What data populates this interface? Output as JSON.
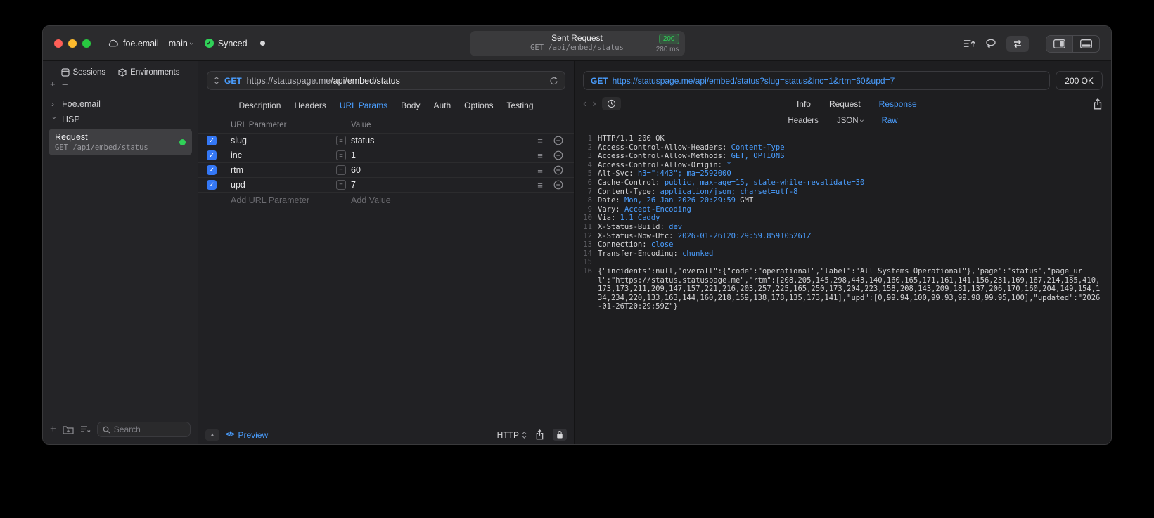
{
  "colors": {
    "accent_blue": "#4A9EFF",
    "success_green": "#30D158",
    "checkbox_blue": "#3478F6",
    "window_bg": "#212123"
  },
  "titlebar": {
    "project": "foe.email",
    "branch": "main",
    "sync_label": "Synced",
    "request_summary": {
      "title": "Sent Request",
      "status_code": "200",
      "method_path": "GET /api/embed/status",
      "duration": "280 ms"
    }
  },
  "sidebar": {
    "tabs": [
      {
        "label": "Sessions"
      },
      {
        "label": "Environments"
      }
    ],
    "tree": [
      {
        "label": "Foe.email"
      },
      {
        "label": "HSP"
      }
    ],
    "request_item": {
      "title": "Request",
      "subtitle": "GET /api/embed/status"
    },
    "search": {
      "placeholder": "Search"
    }
  },
  "request_editor": {
    "method": "GET",
    "url_host": "https://statuspage.me",
    "url_path": "/api/embed/status",
    "active_tab": "URL Params",
    "tabs": [
      {
        "label": "Description"
      },
      {
        "label": "Headers"
      },
      {
        "label": "URL Params"
      },
      {
        "label": "Body"
      },
      {
        "label": "Auth"
      },
      {
        "label": "Options"
      },
      {
        "label": "Testing"
      }
    ],
    "params": {
      "columns": [
        "URL Parameter",
        "Value"
      ],
      "rows": [
        {
          "name": "slug",
          "value": "status",
          "checked": true
        },
        {
          "name": "inc",
          "value": "1",
          "checked": true
        },
        {
          "name": "rtm",
          "value": "60",
          "checked": true
        },
        {
          "name": "upd",
          "value": "7",
          "checked": true
        }
      ],
      "add_param_placeholder": "Add URL Parameter",
      "add_value_placeholder": "Add Value"
    },
    "footer": {
      "preview": "Preview",
      "protocol": "HTTP"
    }
  },
  "response_viewer": {
    "method": "GET",
    "url": "https://statuspage.me/api/embed/status?slug=status&inc=1&rtm=60&upd=7",
    "status": "200 OK",
    "active_tab": "Response",
    "tabs": [
      {
        "label": "Info"
      },
      {
        "label": "Request"
      },
      {
        "label": "Response"
      }
    ],
    "active_subtab": "Raw",
    "subtabs": [
      {
        "label": "Headers"
      },
      {
        "label": "JSON",
        "dropdown": true
      },
      {
        "label": "Raw"
      }
    ],
    "lines": [
      {
        "n": "1",
        "parts": [
          {
            "t": "HTTP/1.1 200 OK",
            "s": "p"
          }
        ]
      },
      {
        "n": "2",
        "parts": [
          {
            "t": "Access-Control-Allow-Headers: ",
            "s": "p"
          },
          {
            "t": "Content-Type",
            "s": "v"
          }
        ]
      },
      {
        "n": "3",
        "parts": [
          {
            "t": "Access-Control-Allow-Methods: ",
            "s": "p"
          },
          {
            "t": "GET, OPTIONS",
            "s": "v"
          }
        ]
      },
      {
        "n": "4",
        "parts": [
          {
            "t": "Access-Control-Allow-Origin: ",
            "s": "p"
          },
          {
            "t": "*",
            "s": "v"
          }
        ]
      },
      {
        "n": "5",
        "parts": [
          {
            "t": "Alt-Svc: ",
            "s": "p"
          },
          {
            "t": "h3=\":443\"; ma=2592000",
            "s": "v"
          }
        ]
      },
      {
        "n": "6",
        "parts": [
          {
            "t": "Cache-Control: ",
            "s": "p"
          },
          {
            "t": "public, max-age=15, stale-while-revalidate=30",
            "s": "v"
          }
        ]
      },
      {
        "n": "7",
        "parts": [
          {
            "t": "Content-Type: ",
            "s": "p"
          },
          {
            "t": "application/json; charset=utf-8",
            "s": "v"
          }
        ]
      },
      {
        "n": "8",
        "parts": [
          {
            "t": "Date: ",
            "s": "p"
          },
          {
            "t": "Mon, 26 Jan 2026 20:29:59",
            "s": "v"
          },
          {
            "t": " GMT",
            "s": "p"
          }
        ]
      },
      {
        "n": "9",
        "parts": [
          {
            "t": "Vary: ",
            "s": "p"
          },
          {
            "t": "Accept-Encoding",
            "s": "v"
          }
        ]
      },
      {
        "n": "10",
        "parts": [
          {
            "t": "Via: ",
            "s": "p"
          },
          {
            "t": "1.1 Caddy",
            "s": "v"
          }
        ]
      },
      {
        "n": "11",
        "parts": [
          {
            "t": "X-Status-Build: ",
            "s": "p"
          },
          {
            "t": "dev",
            "s": "v"
          }
        ]
      },
      {
        "n": "12",
        "parts": [
          {
            "t": "X-Status-Now-Utc: ",
            "s": "p"
          },
          {
            "t": "2026-01-26T20:29:59.859105261Z",
            "s": "v"
          }
        ]
      },
      {
        "n": "13",
        "parts": [
          {
            "t": "Connection: ",
            "s": "p"
          },
          {
            "t": "close",
            "s": "v"
          }
        ]
      },
      {
        "n": "14",
        "parts": [
          {
            "t": "Transfer-Encoding: ",
            "s": "p"
          },
          {
            "t": "chunked",
            "s": "v"
          }
        ]
      },
      {
        "n": "15",
        "parts": []
      },
      {
        "n": "16",
        "parts": [
          {
            "t": "{\"incidents\":null,\"overall\":{\"code\":\"operational\",\"label\":\"All Systems Operational\"},\"page\":\"status\",\"page_url\":\"https://status.statuspage.me\",\"rtm\":[208,205,145,298,443,140,160,165,171,161,141,156,231,169,167,214,185,410,173,173,211,209,147,157,221,216,203,257,225,165,250,173,204,223,158,208,143,209,181,137,206,170,160,204,149,154,134,234,220,133,163,144,160,218,159,138,178,135,173,141],\"upd\":[0,99.94,100,99.93,99.98,99.95,100],\"updated\":\"2026-01-26T20:29:59Z\"}",
            "s": "p"
          }
        ]
      }
    ]
  }
}
